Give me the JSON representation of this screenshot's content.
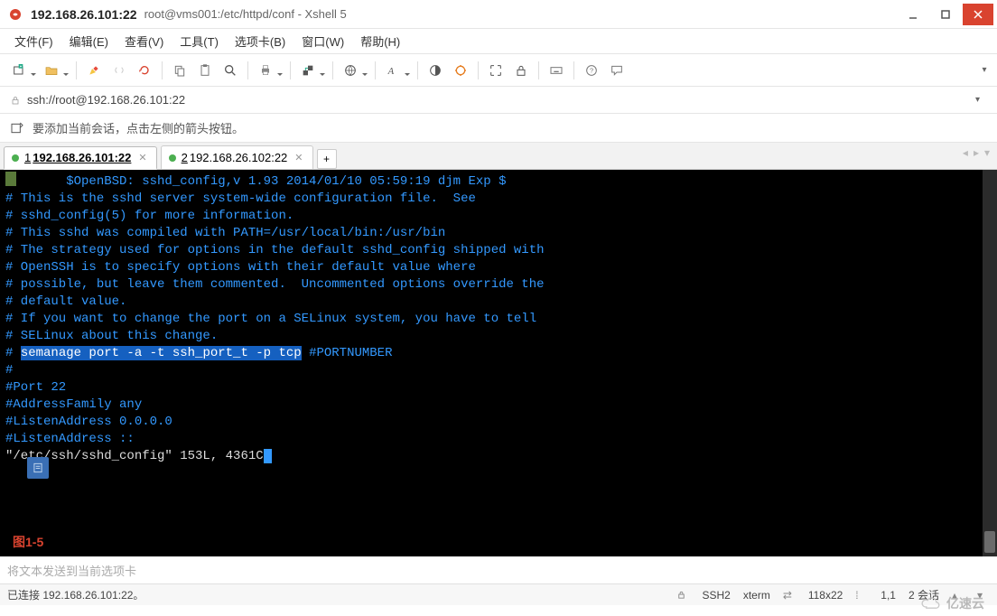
{
  "titlebar": {
    "ip": "192.168.26.101:22",
    "path": "root@vms001:/etc/httpd/conf - Xshell 5"
  },
  "menu": {
    "file": "文件(F)",
    "edit": "编辑(E)",
    "view": "查看(V)",
    "tools": "工具(T)",
    "tab": "选项卡(B)",
    "window": "窗口(W)",
    "help": "帮助(H)"
  },
  "address": {
    "url": "ssh://root@192.168.26.101:22"
  },
  "hint": {
    "text": "要添加当前会话，点击左侧的箭头按钮。"
  },
  "tabs": {
    "items": [
      {
        "num": "1",
        "label": "192.168.26.101:22"
      },
      {
        "num": "2",
        "label": "192.168.26.102:22"
      }
    ],
    "add": "+"
  },
  "terminal": {
    "lines": [
      "#       $OpenBSD: sshd_config,v 1.93 2014/01/10 05:59:19 djm Exp $",
      "",
      "# This is the sshd server system-wide configuration file.  See",
      "# sshd_config(5) for more information.",
      "",
      "# This sshd was compiled with PATH=/usr/local/bin:/usr/bin",
      "",
      "# The strategy used for options in the default sshd_config shipped with",
      "# OpenSSH is to specify options with their default value where",
      "# possible, but leave them commented.  Uncommented options override the",
      "# default value.",
      "",
      "# If you want to change the port on a SELinux system, you have to tell",
      "# SELinux about this change.",
      "",
      "#",
      "#Port 22",
      "#AddressFamily any",
      "#ListenAddress 0.0.0.0",
      "#ListenAddress ::",
      ""
    ],
    "highlight_prefix": "# ",
    "highlight": "semanage port -a -t ssh_port_t -p tcp",
    "highlight_suffix": " #PORTNUMBER",
    "status_line": "\"/etc/ssh/sshd_config\" 153L, 4361C",
    "caption": "图1-5"
  },
  "inputbar": {
    "placeholder": "将文本发送到当前选项卡"
  },
  "statusbar": {
    "left": "已连接 192.168.26.101:22。",
    "ssh": "SSH2",
    "term": "xterm",
    "size": "118x22",
    "pos": "1,1",
    "sessions": "2 会话"
  },
  "watermark": "亿速云"
}
